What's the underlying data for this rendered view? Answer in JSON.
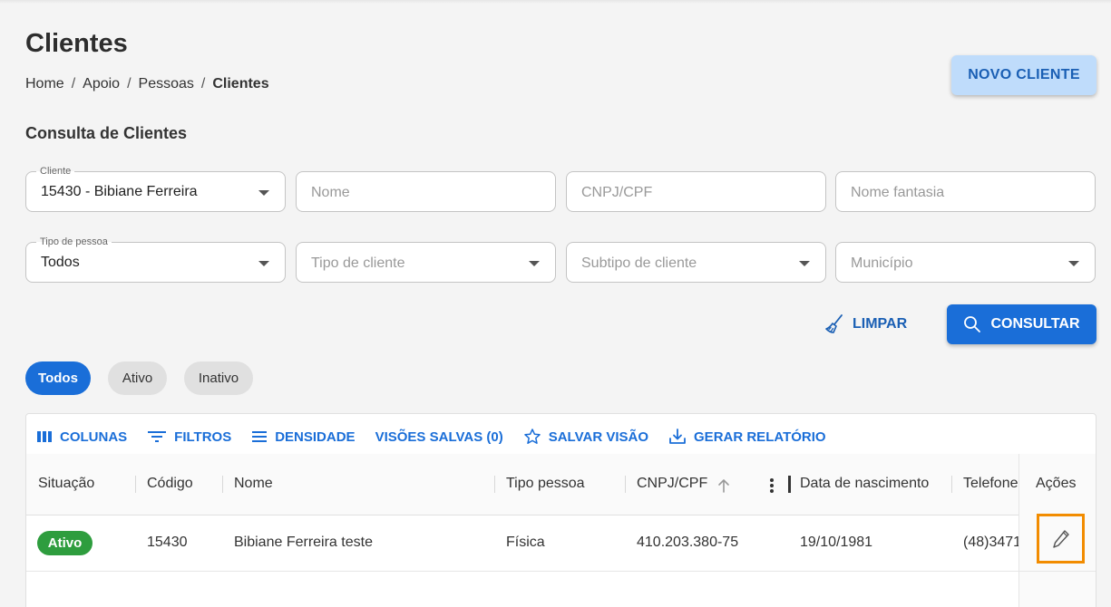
{
  "page": {
    "title": "Clientes"
  },
  "breadcrumb": {
    "items": [
      "Home",
      "Apoio",
      "Pessoas",
      "Clientes"
    ],
    "separator": "/"
  },
  "actions": {
    "novo_cliente": "NOVO CLIENTE",
    "limpar": "LIMPAR",
    "consultar": "CONSULTAR"
  },
  "filters": {
    "section_title": "Consulta de Clientes",
    "cliente": {
      "label": "Cliente",
      "value": "15430 - Bibiane Ferreira"
    },
    "nome": {
      "placeholder": "Nome"
    },
    "cnpj_cpf": {
      "placeholder": "CNPJ/CPF"
    },
    "nome_fantasia": {
      "placeholder": "Nome fantasia"
    },
    "tipo_pessoa": {
      "label": "Tipo de pessoa",
      "value": "Todos"
    },
    "tipo_cliente": {
      "placeholder": "Tipo de cliente"
    },
    "subtipo_cliente": {
      "placeholder": "Subtipo de cliente"
    },
    "municipio": {
      "placeholder": "Município"
    }
  },
  "status_chips": [
    {
      "label": "Todos",
      "active": true
    },
    {
      "label": "Ativo",
      "active": false
    },
    {
      "label": "Inativo",
      "active": false
    }
  ],
  "toolbar": {
    "colunas": "COLUNAS",
    "filtros": "FILTROS",
    "densidade": "DENSIDADE",
    "visoes_salvas": "VISÕES SALVAS (0)",
    "salvar_visao": "SALVAR VISÃO",
    "gerar_relatorio": "GERAR RELATÓRIO"
  },
  "table": {
    "columns": [
      "Situação",
      "Código",
      "Nome",
      "Tipo pessoa",
      "CNPJ/CPF",
      "Data de nascimento",
      "Telefone",
      "Ações"
    ],
    "sort_icon": "arrow-up-icon",
    "rows": [
      {
        "situacao": "Ativo",
        "codigo": "15430",
        "nome": "Bibiane Ferreira teste",
        "tipo_pessoa": "Física",
        "cnpj_cpf": "410.203.380-75",
        "data_nascimento": "19/10/1981",
        "telefone": "(48)3471"
      }
    ]
  },
  "colors": {
    "primary": "#1a6ed8",
    "primary_light": "#bfdcfb",
    "success": "#2e9d3e",
    "highlight": "#f28c00"
  }
}
